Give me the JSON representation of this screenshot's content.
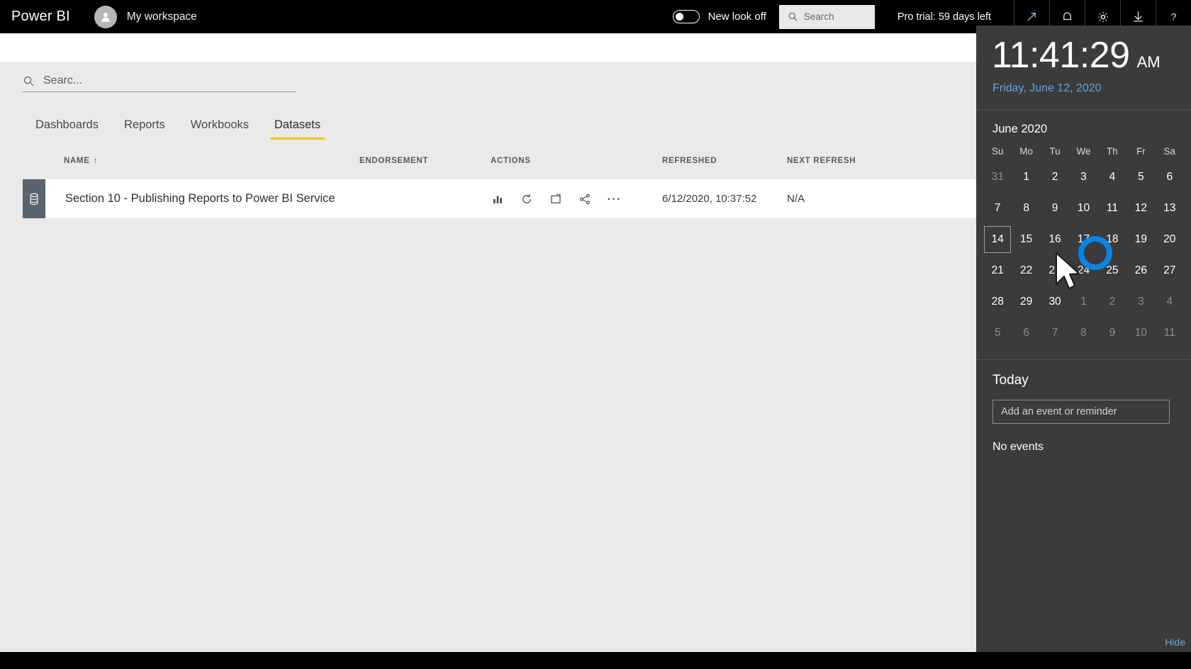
{
  "app": {
    "brand": "Power BI",
    "workspace": "My workspace",
    "new_look_toggle_label": "New look off",
    "new_look_state": "off",
    "header_search_placeholder": "Search",
    "pro_trial": "Pro trial: 59 days left",
    "header_icons": [
      {
        "name": "expand-icon",
        "glyph": "arrow-up-right"
      },
      {
        "name": "notifications-icon",
        "glyph": "bell"
      },
      {
        "name": "settings-icon",
        "glyph": "gear"
      },
      {
        "name": "download-icon",
        "glyph": "download"
      },
      {
        "name": "help-icon",
        "glyph": "question"
      }
    ]
  },
  "content": {
    "search_placeholder": "Searc...",
    "tabs": [
      {
        "label": "Dashboards",
        "active": false
      },
      {
        "label": "Reports",
        "active": false
      },
      {
        "label": "Workbooks",
        "active": false
      },
      {
        "label": "Datasets",
        "active": true
      }
    ],
    "columns": [
      {
        "label": "NAME",
        "sort": "↑"
      },
      {
        "label": "ENDORSEMENT",
        "sort": ""
      },
      {
        "label": "ACTIONS",
        "sort": ""
      },
      {
        "label": "REFRESHED",
        "sort": ""
      },
      {
        "label": "NEXT REFRESH",
        "sort": ""
      }
    ],
    "rows": [
      {
        "name": "Section 10 - Publishing Reports to Power BI Service",
        "endorsement": "",
        "refreshed": "6/12/2020, 10:37:52",
        "next_refresh": "N/A",
        "actions": [
          "analyze-in-excel-icon",
          "refresh-now-icon",
          "create-report-icon",
          "share-icon",
          "more-options-icon"
        ]
      }
    ]
  },
  "flyout": {
    "time": "11:41:29",
    "ampm": "AM",
    "date": "Friday, June 12, 2020",
    "month": "June 2020",
    "dow": [
      "Su",
      "Mo",
      "Tu",
      "We",
      "Th",
      "Fr",
      "Sa"
    ],
    "weeks": [
      [
        {
          "d": "31",
          "muted": true
        },
        {
          "d": "1"
        },
        {
          "d": "2"
        },
        {
          "d": "3"
        },
        {
          "d": "4"
        },
        {
          "d": "5"
        },
        {
          "d": "6"
        }
      ],
      [
        {
          "d": "7"
        },
        {
          "d": "8"
        },
        {
          "d": "9"
        },
        {
          "d": "10"
        },
        {
          "d": "11"
        },
        {
          "d": "12"
        },
        {
          "d": "13"
        }
      ],
      [
        {
          "d": "14",
          "selected": true
        },
        {
          "d": "15"
        },
        {
          "d": "16"
        },
        {
          "d": "17"
        },
        {
          "d": "18"
        },
        {
          "d": "19"
        },
        {
          "d": "20"
        }
      ],
      [
        {
          "d": "21"
        },
        {
          "d": "22"
        },
        {
          "d": "23"
        },
        {
          "d": "24"
        },
        {
          "d": "25"
        },
        {
          "d": "26"
        },
        {
          "d": "27"
        }
      ],
      [
        {
          "d": "28"
        },
        {
          "d": "29"
        },
        {
          "d": "30"
        },
        {
          "d": "1",
          "muted": true
        },
        {
          "d": "2",
          "muted": true
        },
        {
          "d": "3",
          "muted": true
        },
        {
          "d": "4",
          "muted": true
        }
      ],
      [
        {
          "d": "5",
          "muted": true
        },
        {
          "d": "6",
          "muted": true
        },
        {
          "d": "7",
          "muted": true
        },
        {
          "d": "8",
          "muted": true
        },
        {
          "d": "9",
          "muted": true
        },
        {
          "d": "10",
          "muted": true
        },
        {
          "d": "11",
          "muted": true
        }
      ]
    ],
    "today_title": "Today",
    "event_placeholder": "Add an event or reminder",
    "no_events": "No events",
    "footer_link": "Hide"
  },
  "colors": {
    "brand_yellow": "#f2c811",
    "accent_blue": "#0a84e0",
    "date_blue": "#5fa3de",
    "flyout_bg": "#3b3b3b",
    "header_bg": "#000000",
    "content_bg": "#eaeaea",
    "row_tile": "#5a6470"
  }
}
